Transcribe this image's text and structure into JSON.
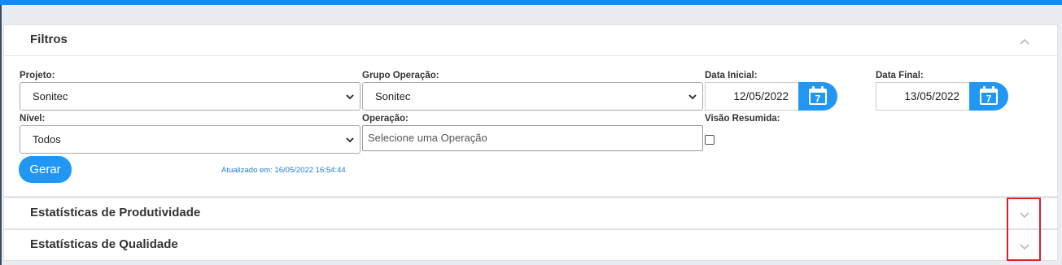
{
  "filters": {
    "title": "Filtros",
    "projeto": {
      "label": "Projeto:",
      "value": "Sonitec"
    },
    "grupo": {
      "label": "Grupo Operação:",
      "value": "Sonitec"
    },
    "data_inicial": {
      "label": "Data Inicial:",
      "value": "12/05/2022"
    },
    "data_final": {
      "label": "Data Final:",
      "value": "13/05/2022"
    },
    "nivel": {
      "label": "Nível:",
      "value": "Todos"
    },
    "operacao": {
      "label": "Operação:",
      "placeholder": "Selecione uma Operação"
    },
    "visao": {
      "label": "Visão Resumida:",
      "checked": false
    },
    "gerar_label": "Gerar",
    "updated": "Atualizado em: 16/05/2022 16:54:44",
    "calendar_day": "7"
  },
  "sections": {
    "produtividade": "Estatísticas de Produtividade",
    "qualidade": "Estatísticas de Qualidade"
  },
  "colors": {
    "accent": "#2196f3",
    "highlight": "#d9202a"
  }
}
